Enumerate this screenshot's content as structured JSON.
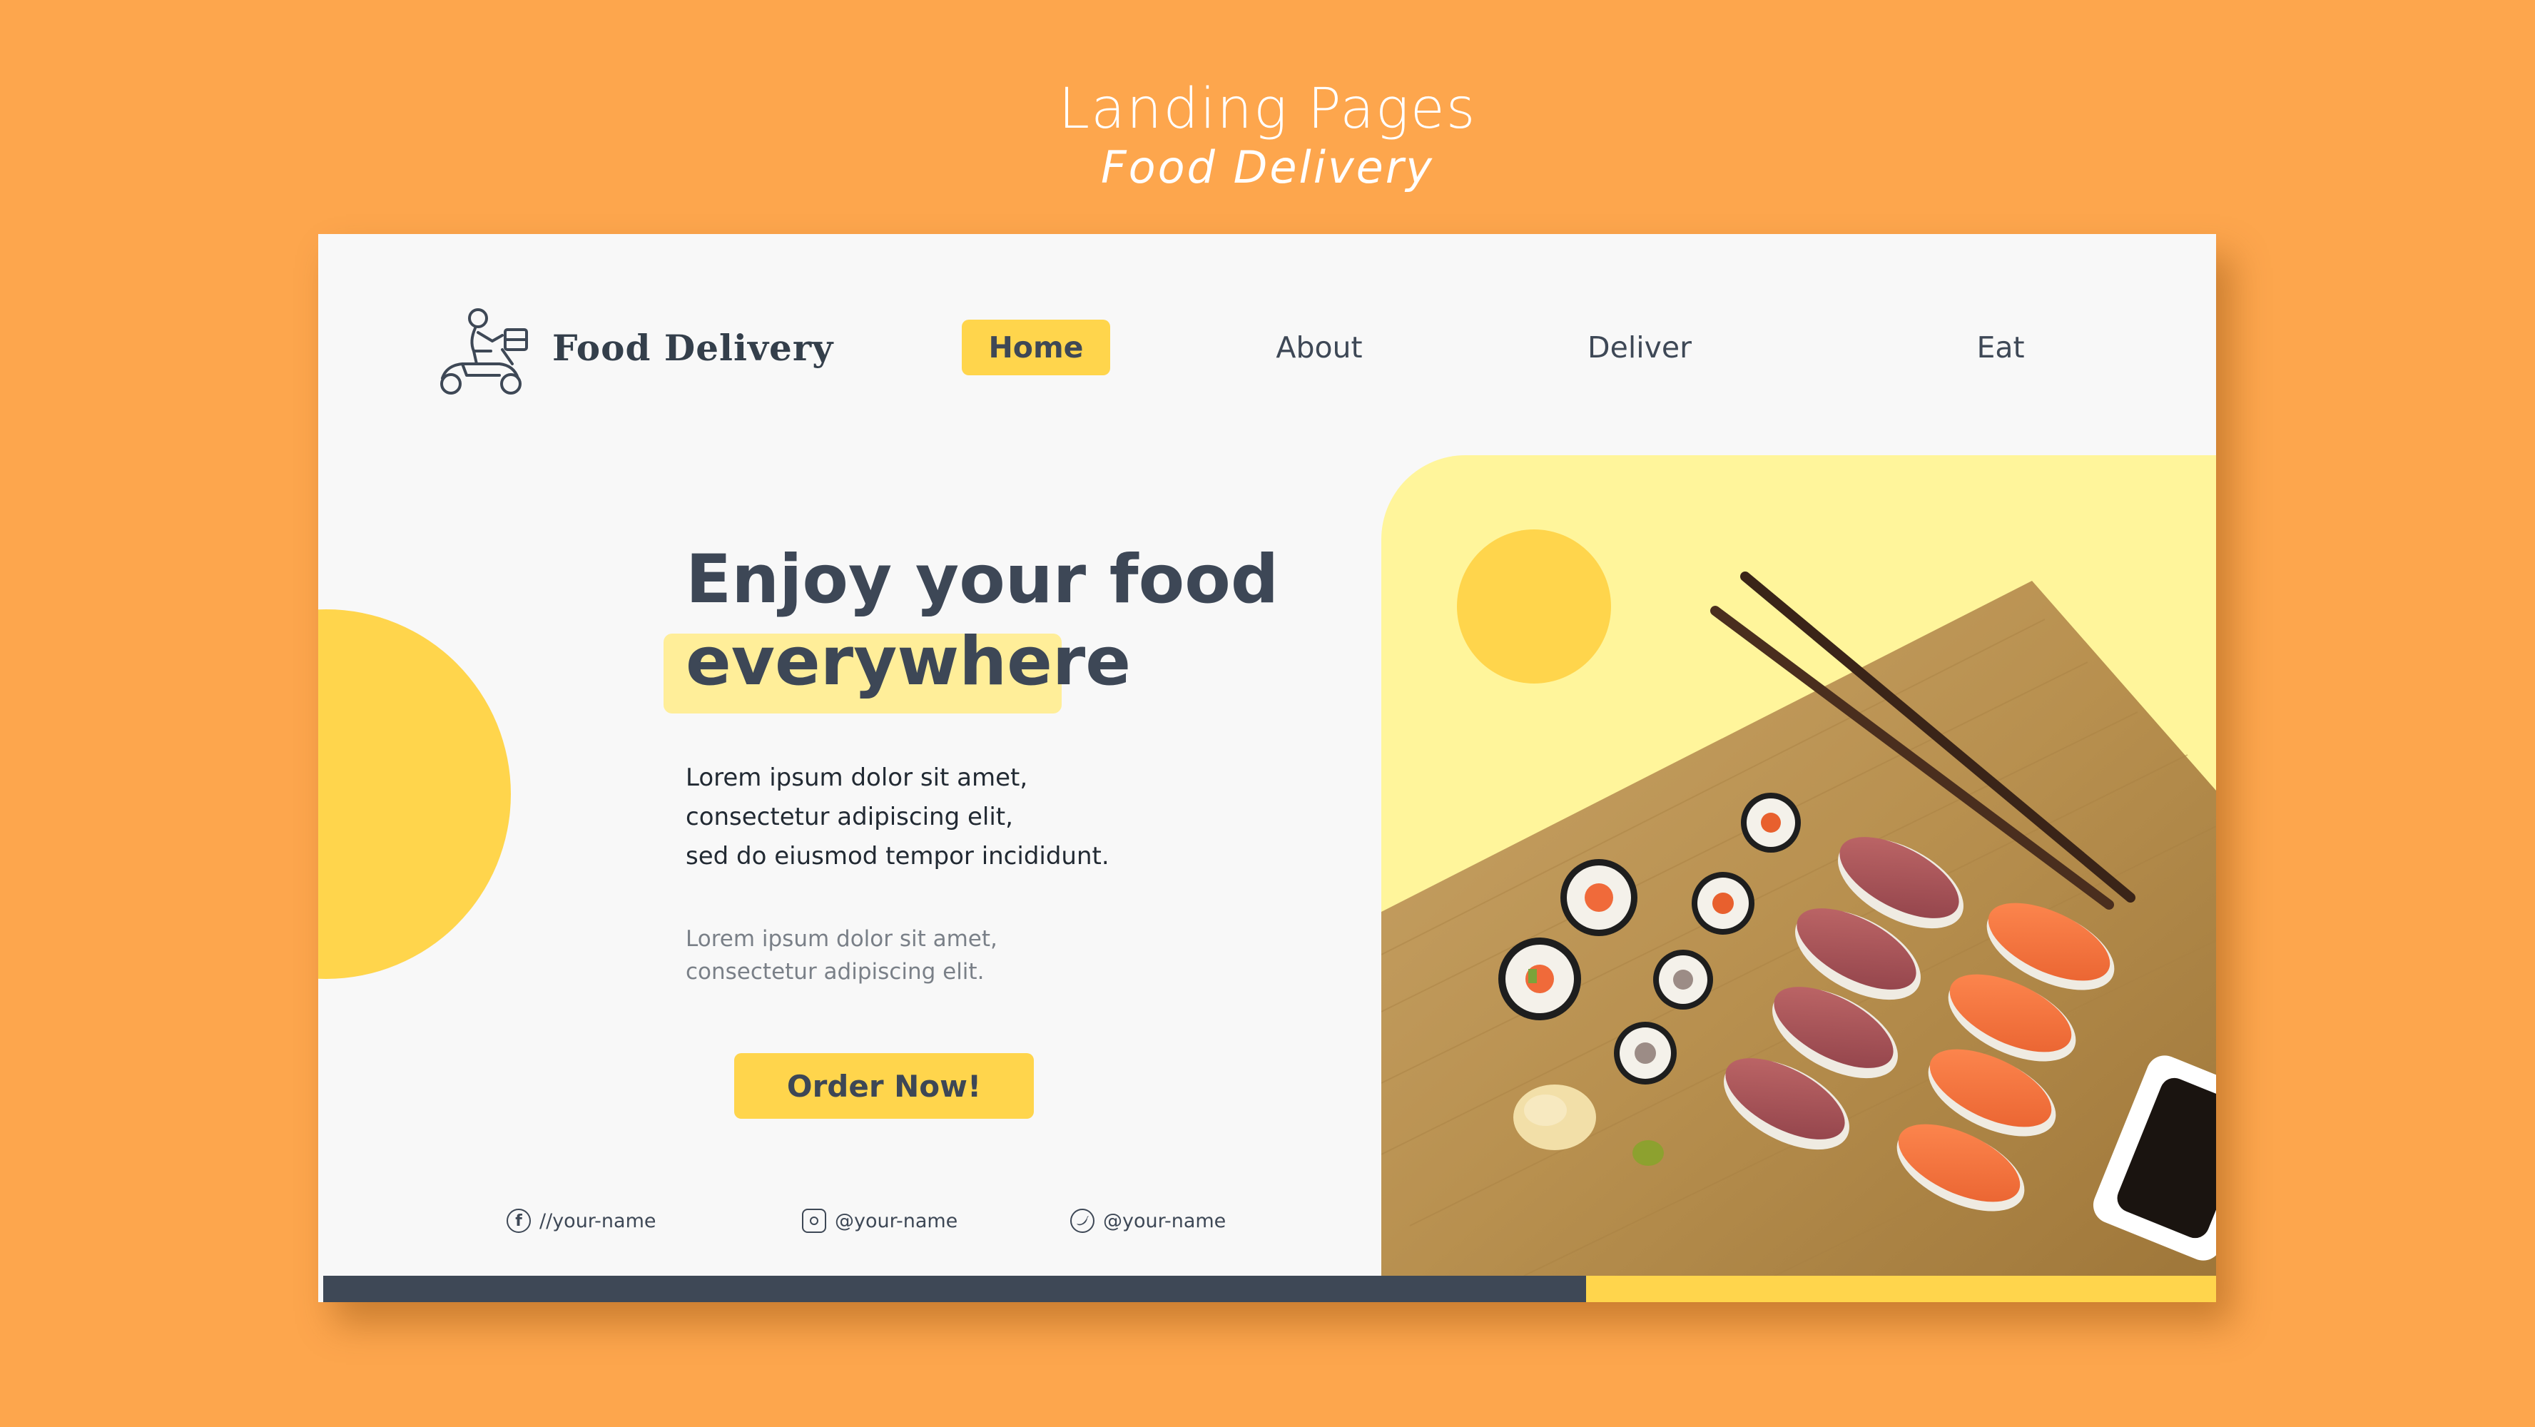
{
  "showcase": {
    "title": "Landing Pages",
    "subtitle": "Food Delivery"
  },
  "header": {
    "logo_text": "Food Delivery",
    "logo_icon": "scooter-delivery-icon",
    "nav": {
      "home": "Home",
      "about": "About",
      "deliver": "Deliver",
      "eat": "Eat"
    },
    "active_item": "Home"
  },
  "hero": {
    "headline_line1": "Enjoy your food",
    "headline_line2": "everywhere",
    "body_lines": [
      "Lorem ipsum dolor sit amet,",
      "consectetur adipiscing elit,",
      "sed do eiusmod tempor incididunt."
    ],
    "sub_lines": [
      "Lorem ipsum dolor sit amet,",
      "consectetur adipiscing elit."
    ],
    "cta_label": "Order Now!"
  },
  "socials": {
    "facebook": {
      "icon": "facebook-icon",
      "handle": "//your-name"
    },
    "instagram": {
      "icon": "instagram-icon",
      "handle": "@your-name"
    },
    "twitter": {
      "icon": "twitter-icon",
      "handle": "@your-name"
    }
  },
  "image": {
    "subject": "sushi platter on bamboo board with chopsticks"
  },
  "colors": {
    "background": "#FDA64D",
    "accent_yellow": "#FFD54C",
    "pale_yellow": "#FFF59B",
    "dark_text": "#3D4756",
    "page_bg": "#F8F8F8"
  }
}
